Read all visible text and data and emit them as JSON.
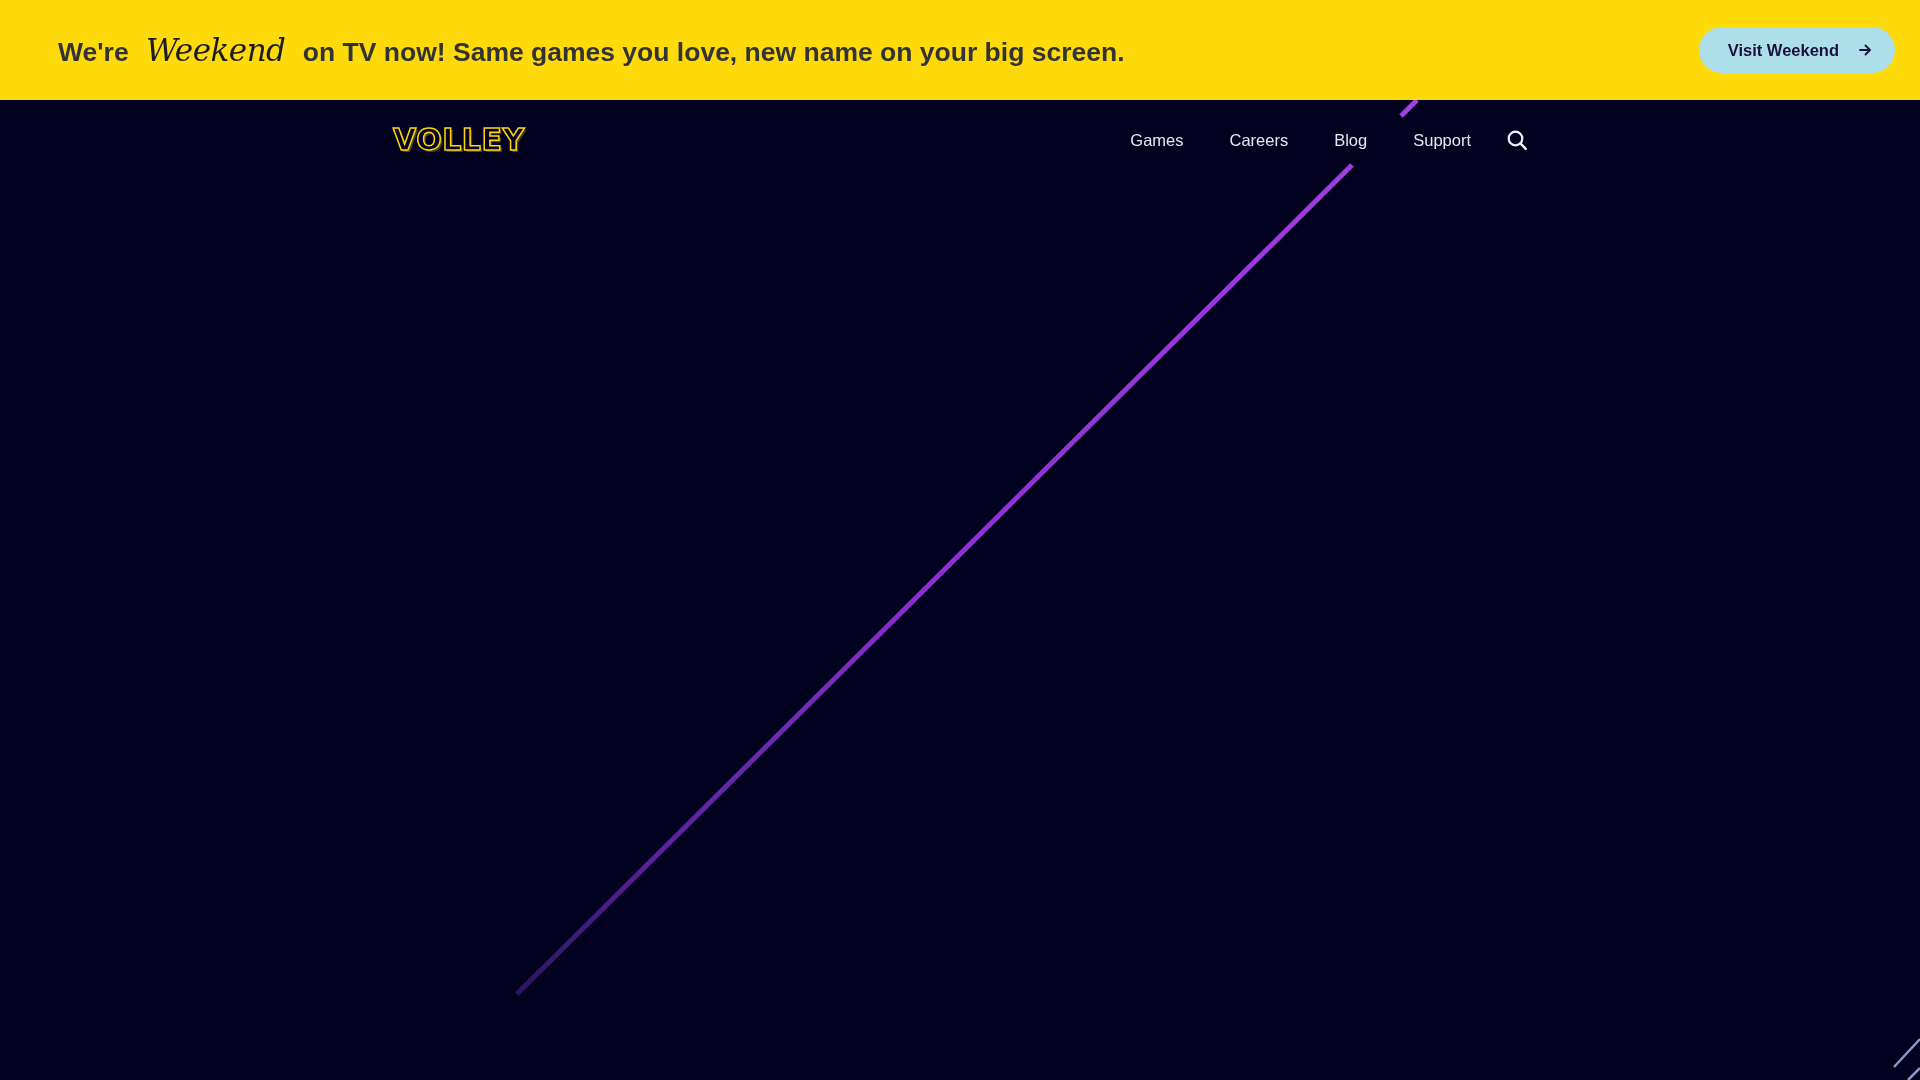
{
  "banner": {
    "message": "We're *Weekend* on TV now! Same games you love, new name on your big screen.",
    "button": {
      "label": "Visit Weekend"
    }
  },
  "header": {
    "logo": "VOLLEY",
    "nav": [
      {
        "label": "Games"
      },
      {
        "label": "Careers"
      },
      {
        "label": "Blog"
      },
      {
        "label": "Support"
      }
    ]
  }
}
